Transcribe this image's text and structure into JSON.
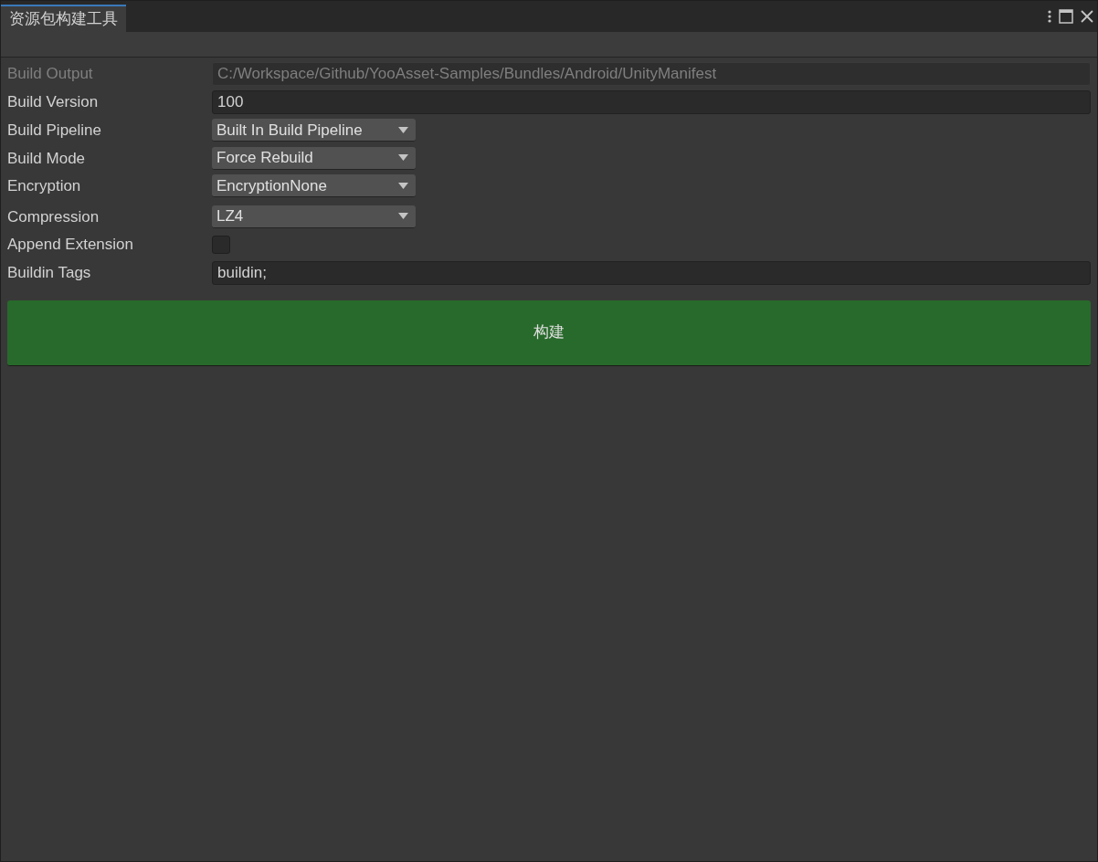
{
  "window": {
    "tab_title": "资源包构建工具"
  },
  "fields": [
    {
      "kind": "text",
      "label": "Build Output",
      "value": "C:/Workspace/Github/YooAsset-Samples/Bundles/Android/UnityManifest",
      "disabled": true
    },
    {
      "kind": "text",
      "label": "Build Version",
      "value": "100",
      "disabled": false
    },
    {
      "kind": "dropdown",
      "label": "Build Pipeline",
      "value": "Built In Build Pipeline"
    },
    {
      "kind": "dropdown",
      "label": "Build Mode",
      "value": "Force Rebuild"
    },
    {
      "kind": "dropdown",
      "label": "Encryption",
      "value": "EncryptionNone"
    },
    {
      "kind": "dropdown",
      "label": "Compression",
      "value": "LZ4"
    },
    {
      "kind": "checkbox",
      "label": "Append Extension",
      "checked": false
    },
    {
      "kind": "text",
      "label": "Buildin Tags",
      "value": "buildin;",
      "disabled": false
    }
  ],
  "build_button": {
    "label": "构建"
  }
}
